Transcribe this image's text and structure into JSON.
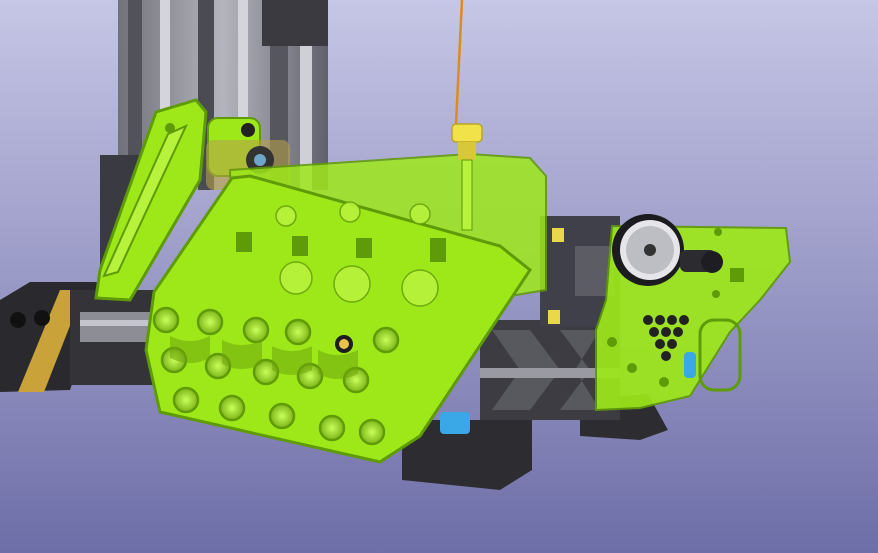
{
  "viewport": {
    "background_top": "#c6c6e6",
    "background_bottom": "#6e6ea8",
    "colors": {
      "lime_part": "#9ee81a",
      "lime_dark": "#5f9a08",
      "aluminum_frame": "#8a8a92",
      "black_parts": "#2a2a2e",
      "gold_trim": "#c9a23a",
      "yellow_bolt": "#f2e24a",
      "orange_wire": "#e08a1e",
      "blue_fittings": "#3aa7e6"
    },
    "icons": [
      "gear-pulley-icon",
      "bolt-icon",
      "wire-icon"
    ]
  }
}
